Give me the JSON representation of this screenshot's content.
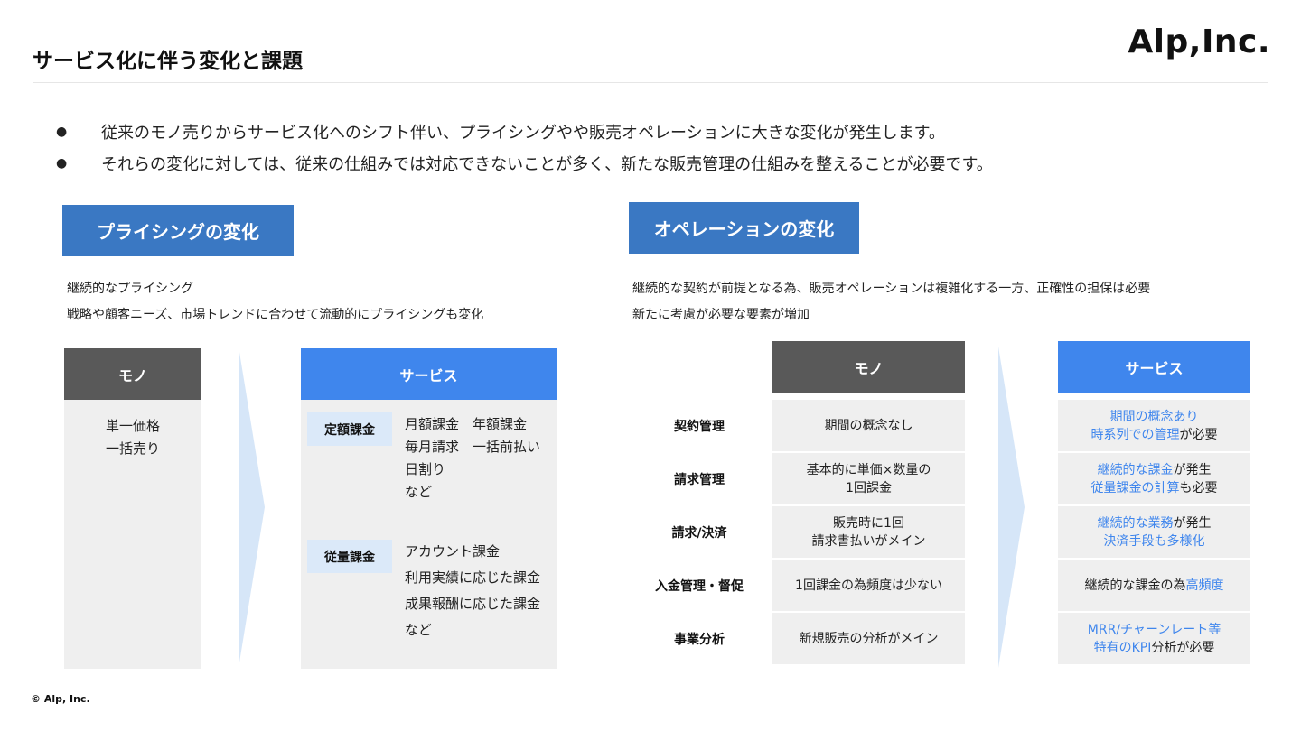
{
  "header": {
    "title": "サービス化に伴う変化と課題",
    "logo": "Alp,Inc."
  },
  "bullets": [
    "従来のモノ売りからサービス化へのシフト伴い、プライシングやや販売オペレーションに大きな変化が発生します。",
    "それらの変化に対しては、従来の仕組みでは対応できないことが多く、新たな販売管理の仕組みを整えることが必要です。"
  ],
  "pricing": {
    "heading": "プライシングの変化",
    "desc": [
      "継続的なプライシング",
      "戦略や顧客ニーズ、市場トレンドに合わせて流動的にプライシングも変化"
    ],
    "mono": {
      "header": "モノ",
      "lines": [
        "単一価格",
        "一括売り"
      ]
    },
    "service": {
      "header": "サービス",
      "groups": [
        {
          "tag": "定額課金",
          "items": [
            "月額課金　年額課金",
            "毎月請求　一括前払い",
            "日割り",
            "など"
          ]
        },
        {
          "tag": "従量課金",
          "items": [
            "アカウント課金",
            "利用実績に応じた課金",
            "成果報酬に応じた課金",
            "など"
          ]
        }
      ]
    }
  },
  "operation": {
    "heading": "オペレーションの変化",
    "desc": [
      "継続的な契約が前提となる為、販売オペレーションは複雑化する一方、正確性の担保は必要",
      "新たに考慮が必要な要素が増加"
    ],
    "mono_header": "モノ",
    "service_header": "サービス",
    "rows": [
      {
        "label": "契約管理",
        "mono": [
          "期間の概念なし"
        ],
        "service": [
          [
            {
              "t": "期間の概念あり",
              "hl": true
            }
          ],
          [
            {
              "t": "時系列での管理",
              "hl": true
            },
            {
              "t": "が必要",
              "hl": false
            }
          ]
        ]
      },
      {
        "label": "請求管理",
        "mono": [
          "基本的に単価×数量の",
          "1回課金"
        ],
        "service": [
          [
            {
              "t": "継続的な課金",
              "hl": true
            },
            {
              "t": "が発生",
              "hl": false
            }
          ],
          [
            {
              "t": "従量課金の計算",
              "hl": true
            },
            {
              "t": "も必要",
              "hl": false
            }
          ]
        ]
      },
      {
        "label": "請求/決済",
        "mono": [
          "販売時に1回",
          "請求書払いがメイン"
        ],
        "service": [
          [
            {
              "t": "継続的な業務",
              "hl": true
            },
            {
              "t": "が発生",
              "hl": false
            }
          ],
          [
            {
              "t": "決済手段も多様化",
              "hl": true
            }
          ]
        ]
      },
      {
        "label": "入金管理・督促",
        "mono": [
          "1回課金の為頻度は少ない"
        ],
        "service": [
          [
            {
              "t": "継続的な課金の為",
              "hl": false
            },
            {
              "t": "高頻度",
              "hl": true
            }
          ]
        ]
      },
      {
        "label": "事業分析",
        "mono": [
          "新規販売の分析がメイン"
        ],
        "service": [
          [
            {
              "t": "MRR/チャーンレート等",
              "hl": true
            }
          ],
          [
            {
              "t": "特有のKPI",
              "hl": true
            },
            {
              "t": "分析が必要",
              "hl": false
            }
          ]
        ]
      }
    ]
  },
  "footer": {
    "copyright": "© Alp, Inc."
  },
  "colors": {
    "section_blue": "#3a78c3",
    "service_blue": "#3f86ed",
    "mono_gray": "#595959",
    "highlight": "#3f86ed"
  }
}
